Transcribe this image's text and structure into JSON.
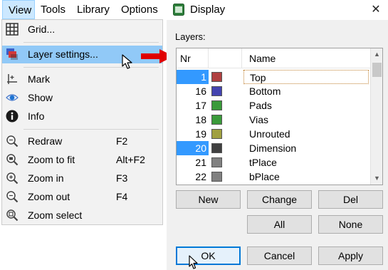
{
  "menubar": {
    "view": "View",
    "tools": "Tools",
    "library": "Library",
    "options": "Options"
  },
  "view_menu": {
    "grid": "Grid...",
    "layer_settings": "Layer settings...",
    "mark": "Mark",
    "show": "Show",
    "info": "Info",
    "redraw": "Redraw",
    "redraw_shortcut": "F2",
    "zoom_to_fit": "Zoom to fit",
    "zoom_to_fit_shortcut": "Alt+F2",
    "zoom_in": "Zoom in",
    "zoom_in_shortcut": "F3",
    "zoom_out": "Zoom out",
    "zoom_out_shortcut": "F4",
    "zoom_select": "Zoom select"
  },
  "dialog": {
    "title": "Display",
    "close": "✕",
    "layers_label": "Layers:",
    "columns": {
      "nr": "Nr",
      "color": "",
      "name": "Name"
    },
    "layers": [
      {
        "nr": "1",
        "name": "Top",
        "color": "#b04040",
        "selected": true
      },
      {
        "nr": "16",
        "name": "Bottom",
        "color": "#4444b0",
        "selected": false
      },
      {
        "nr": "17",
        "name": "Pads",
        "color": "#3a9a3a",
        "selected": false
      },
      {
        "nr": "18",
        "name": "Vias",
        "color": "#3a9a3a",
        "selected": false
      },
      {
        "nr": "19",
        "name": "Unrouted",
        "color": "#a0a040",
        "selected": false
      },
      {
        "nr": "20",
        "name": "Dimension",
        "color": "#404040",
        "selected": true
      },
      {
        "nr": "21",
        "name": "tPlace",
        "color": "#808080",
        "selected": false
      },
      {
        "nr": "22",
        "name": "bPlace",
        "color": "#808080",
        "selected": false
      }
    ],
    "buttons": {
      "new": "New",
      "change": "Change",
      "del": "Del",
      "all": "All",
      "none": "None",
      "ok": "OK",
      "cancel": "Cancel",
      "apply": "Apply"
    }
  },
  "colors": {
    "menu_highlight": "#91c9f7",
    "selection": "#3399ff",
    "arrow": "#e00000"
  }
}
